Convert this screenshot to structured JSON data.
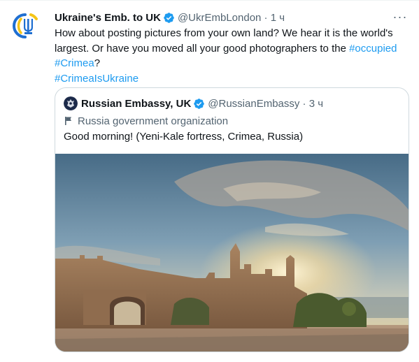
{
  "tweet": {
    "author_name": "Ukraine's Emb. to UK",
    "handle": "@UkrEmbLondon",
    "separator": " · ",
    "time": "1 ч",
    "more_label": "···",
    "text_part1": "How about posting pictures from your own land? We hear it is the world's largest. Or have you moved all your good photographers to the ",
    "link_occupied": "#occupied",
    "link_crimea": "#Crimea",
    "text_part2": "?",
    "link_crimea_is_ukraine": "#CrimeaIsUkraine"
  },
  "quoted_tweet": {
    "author_name": "Russian Embassy, UK",
    "handle": "@RussianEmbassy",
    "separator": " · ",
    "time": "3 ч",
    "label": "Russia government organization",
    "text": "Good morning! (Yeni-Kale fortress, Crimea, Russia)",
    "image": "photo of Yeni-Kale fortress"
  },
  "icons": {
    "verified": "verified-badge-icon",
    "more": "more-options-icon",
    "flag": "government-flag-icon",
    "avatar_ukraine": "trident-logo",
    "avatar_russia": "russian-coat-of-arms"
  },
  "colors": {
    "link": "#1d9bf0",
    "muted": "#536471",
    "text": "#0f1419",
    "border": "#cfd9de"
  }
}
